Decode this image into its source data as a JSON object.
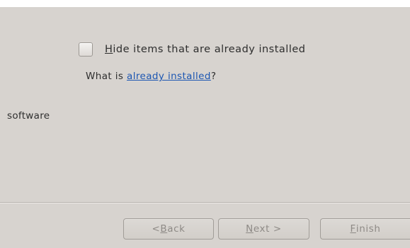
{
  "options": {
    "hide_installed_mnemonic": "H",
    "hide_installed_label_rest": "ide items that are already installed",
    "hide_installed_checked": false
  },
  "info": {
    "prefix": "What is ",
    "link_text": "already installed",
    "suffix": "?"
  },
  "side_text": "software",
  "buttons": {
    "back_prefix": "< ",
    "back_mnemonic": "B",
    "back_rest": "ack",
    "next_mnemonic": "N",
    "next_rest": "ext >",
    "finish_mnemonic": "F",
    "finish_rest": "inish"
  }
}
